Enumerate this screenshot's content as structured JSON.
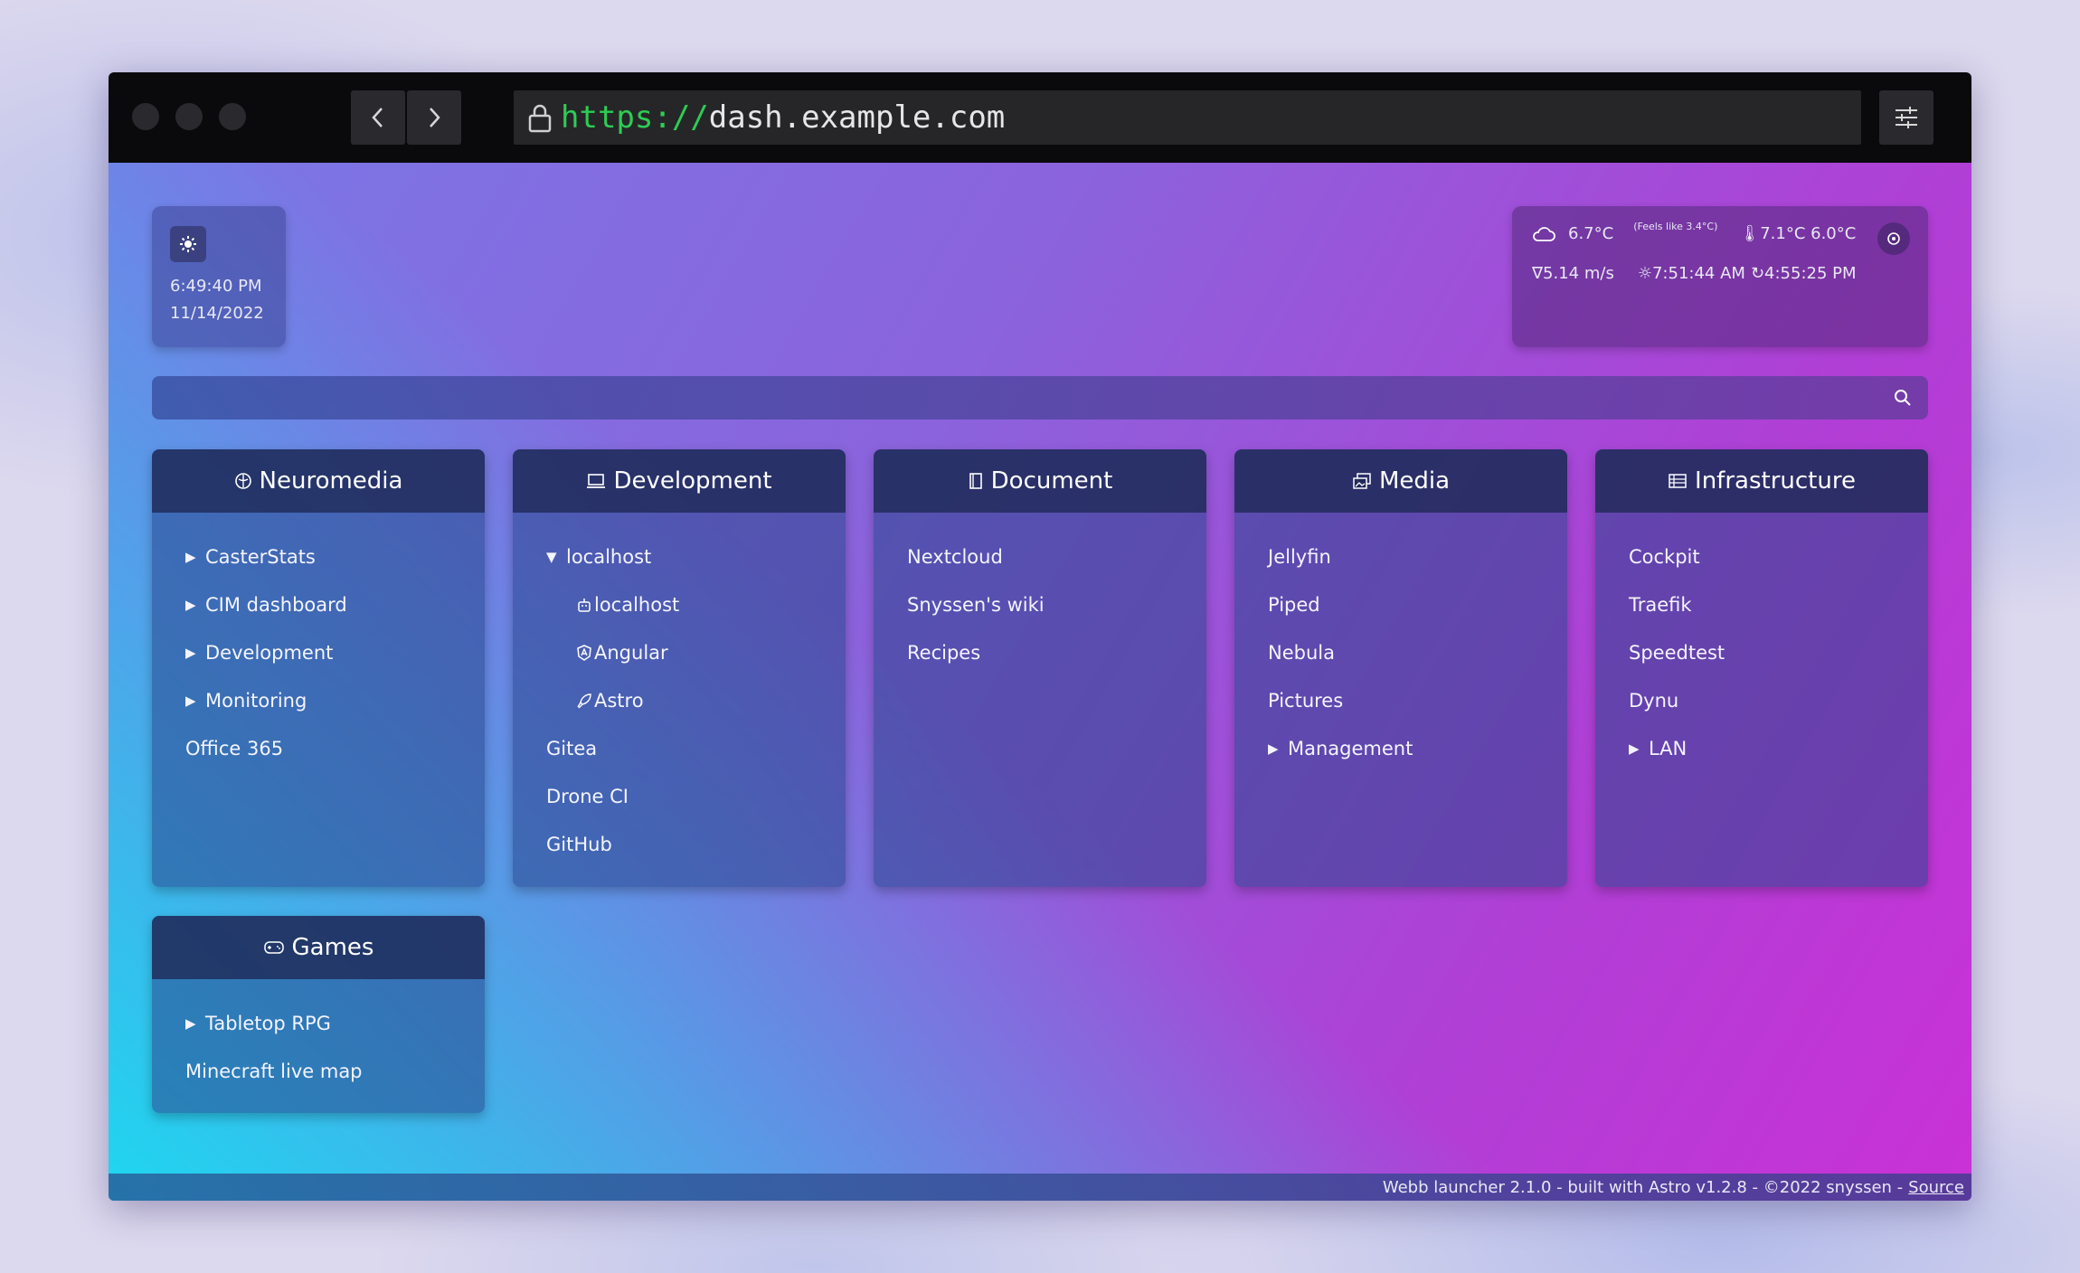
{
  "browser": {
    "url_scheme": "https://",
    "url_host": "dash.example.com"
  },
  "clock": {
    "time": "6:49:40 PM",
    "date": "11/14/2022"
  },
  "weather": {
    "temperature": "6.7°C",
    "feels_like": "(Feels like 3.4°C)",
    "temp_range": "7.1°C 6.0°C",
    "wind": "5.14 m/s",
    "sunrise": "7:51:44 AM",
    "sunset": "4:55:25 PM"
  },
  "search": {
    "value": "",
    "placeholder": ""
  },
  "cards": {
    "neuromedia": {
      "title": "Neuromedia",
      "items": [
        "CasterStats",
        "CIM dashboard",
        "Development",
        "Monitoring",
        "Office 365"
      ]
    },
    "development": {
      "title": "Development",
      "group": "localhost",
      "subitems": [
        "localhost",
        "Angular",
        "Astro"
      ],
      "items": [
        "Gitea",
        "Drone CI",
        "GitHub"
      ]
    },
    "document": {
      "title": "Document",
      "items": [
        "Nextcloud",
        "Snyssen's wiki",
        "Recipes"
      ]
    },
    "media": {
      "title": "Media",
      "items": [
        "Jellyfin",
        "Piped",
        "Nebula",
        "Pictures",
        "Management"
      ]
    },
    "infrastructure": {
      "title": "Infrastructure",
      "items": [
        "Cockpit",
        "Traefik",
        "Speedtest",
        "Dynu",
        "LAN"
      ]
    },
    "games": {
      "title": "Games",
      "items": [
        "Tabletop RPG",
        "Minecraft live map"
      ]
    }
  },
  "footer": {
    "text": "Webb launcher 2.1.0 - built with Astro v1.2.8 - ©2022 snyssen -",
    "link": "Source"
  }
}
